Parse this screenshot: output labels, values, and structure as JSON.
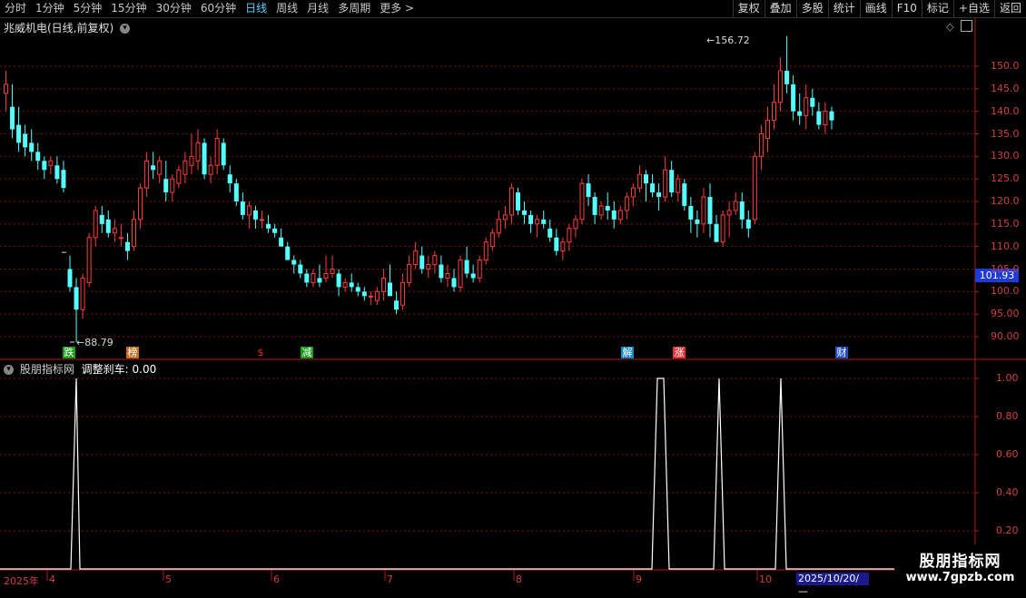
{
  "toolbar": {
    "periods": [
      "分时",
      "1分钟",
      "5分钟",
      "15分钟",
      "30分钟",
      "60分钟",
      "日线",
      "周线",
      "月线",
      "多周期",
      "更多 >"
    ],
    "active_period": "日线",
    "tools": [
      "复权",
      "叠加",
      "多股",
      "统计",
      "画线",
      "F10",
      "标记",
      "+自选",
      "返回"
    ]
  },
  "main_chart": {
    "title": "兆威机电(日线,前复权)",
    "high_label": "156.72",
    "low_label": "88.79",
    "current_price": "101.93",
    "y_ticks": [
      "150.0",
      "145.0",
      "140.0",
      "135.0",
      "130.0",
      "125.0",
      "120.0",
      "115.0",
      "110.0",
      "105.0",
      "100.0",
      "95.00",
      "90.00"
    ],
    "markers": [
      {
        "text": "跌",
        "color": "#1a9e1a"
      },
      {
        "text": "榜",
        "color": "#c07020"
      },
      {
        "text": "$",
        "color": "#e03030"
      },
      {
        "text": "减",
        "color": "#1a9e1a"
      },
      {
        "text": "解",
        "color": "#1a8ac0"
      },
      {
        "text": "涨",
        "color": "#e03030"
      },
      {
        "text": "财",
        "color": "#2050c0"
      }
    ]
  },
  "indicator": {
    "name": "股朋指标网",
    "line_label": "调整刹车: 0.00",
    "y_ticks": [
      "1.00",
      "0.80",
      "0.60",
      "0.40",
      "0.20"
    ]
  },
  "x_axis": {
    "year_label": "2025年",
    "months": [
      "4",
      "5",
      "6",
      "7",
      "8",
      "9",
      "10"
    ],
    "cursor_date": "2025/10/20/—"
  },
  "watermark": {
    "line1": "股朋指标网",
    "line2": "www.7gpzb.com"
  },
  "colors": {
    "up": "#ff3c3c",
    "down": "#54ffff",
    "grid": "#7a1010",
    "axis_text": "#d04040",
    "price_box": "#1e3ad8"
  },
  "chart_data": {
    "type": "candlestick",
    "ylim": [
      86,
      158
    ],
    "ohlc": [
      [
        144,
        149,
        140,
        146
      ],
      [
        141,
        146,
        134,
        136
      ],
      [
        137,
        141,
        131,
        133
      ],
      [
        135,
        137,
        130,
        132
      ],
      [
        133,
        136,
        129,
        131
      ],
      [
        131,
        133,
        127,
        129
      ],
      [
        129,
        130,
        125,
        127
      ],
      [
        128,
        130,
        126,
        129
      ],
      [
        128,
        130,
        124,
        125
      ],
      [
        127,
        129,
        122,
        123
      ],
      [
        105,
        108,
        100,
        101
      ],
      [
        101,
        103,
        88.79,
        96
      ],
      [
        96,
        104,
        94,
        103
      ],
      [
        102,
        113,
        101,
        112
      ],
      [
        112,
        119,
        110,
        118
      ],
      [
        117,
        119,
        113,
        115
      ],
      [
        116,
        118,
        112,
        113
      ],
      [
        113,
        116,
        111,
        114
      ],
      [
        112,
        115,
        110,
        112
      ],
      [
        111,
        113,
        107,
        109
      ],
      [
        110,
        118,
        109,
        116
      ],
      [
        116,
        124,
        114,
        123
      ],
      [
        123,
        131,
        121,
        129
      ],
      [
        128,
        131,
        125,
        127
      ],
      [
        126,
        130,
        124,
        129
      ],
      [
        125,
        129,
        120,
        122
      ],
      [
        122,
        126,
        120,
        125
      ],
      [
        124,
        128,
        123,
        127
      ],
      [
        126,
        131,
        124,
        129
      ],
      [
        128,
        135,
        126,
        130
      ],
      [
        129,
        136,
        127,
        133
      ],
      [
        133,
        134,
        125,
        126
      ],
      [
        126,
        130,
        124,
        128
      ],
      [
        128,
        136,
        126,
        134
      ],
      [
        133,
        134,
        127,
        128
      ],
      [
        126,
        128,
        122,
        124
      ],
      [
        124,
        125,
        119,
        120
      ],
      [
        120,
        122,
        116,
        117
      ],
      [
        117,
        120,
        114,
        119
      ],
      [
        118,
        119,
        114,
        116
      ],
      [
        116,
        118,
        114,
        116
      ],
      [
        115,
        117,
        113,
        114
      ],
      [
        114,
        115,
        112,
        113
      ],
      [
        112,
        114,
        110,
        110
      ],
      [
        110,
        111,
        107,
        107
      ],
      [
        107,
        108,
        104,
        106
      ],
      [
        106,
        107,
        103,
        104
      ],
      [
        104,
        105,
        101,
        102
      ],
      [
        102,
        105,
        101,
        104
      ],
      [
        103,
        106,
        101,
        102
      ],
      [
        103,
        108,
        102,
        104
      ],
      [
        104,
        108,
        103,
        105
      ],
      [
        104,
        105,
        99,
        101
      ],
      [
        101,
        103,
        100,
        102
      ],
      [
        102,
        104,
        100,
        101
      ],
      [
        101,
        102,
        99,
        100
      ],
      [
        100,
        101,
        98,
        99
      ],
      [
        99,
        100,
        97,
        99
      ],
      [
        98,
        101,
        97,
        100
      ],
      [
        100,
        105,
        98,
        103
      ],
      [
        102,
        106,
        99,
        99
      ],
      [
        98,
        100,
        95,
        96
      ],
      [
        97,
        104,
        96,
        102
      ],
      [
        102,
        108,
        101,
        106
      ],
      [
        106,
        111,
        105,
        109
      ],
      [
        108,
        110,
        104,
        105
      ],
      [
        105,
        108,
        103,
        106
      ],
      [
        106,
        109,
        104,
        108
      ],
      [
        106,
        108,
        102,
        103
      ],
      [
        103,
        106,
        101,
        104
      ],
      [
        103,
        105,
        100,
        101
      ],
      [
        101,
        108,
        100,
        107
      ],
      [
        107,
        110,
        103,
        104
      ],
      [
        104,
        106,
        102,
        103
      ],
      [
        103,
        108,
        102,
        107
      ],
      [
        107,
        112,
        106,
        111
      ],
      [
        110,
        114,
        109,
        113
      ],
      [
        113,
        118,
        112,
        116
      ],
      [
        116,
        119,
        114,
        117
      ],
      [
        117,
        124,
        115,
        123
      ],
      [
        122,
        123,
        117,
        118
      ],
      [
        118,
        120,
        115,
        117
      ],
      [
        117,
        118,
        113,
        115
      ],
      [
        115,
        117,
        112,
        116
      ],
      [
        116,
        118,
        114,
        115
      ],
      [
        114,
        116,
        111,
        112
      ],
      [
        112,
        114,
        108,
        109
      ],
      [
        109,
        112,
        107,
        111
      ],
      [
        111,
        115,
        109,
        114
      ],
      [
        114,
        117,
        112,
        116
      ],
      [
        116,
        125,
        115,
        124
      ],
      [
        124,
        126,
        119,
        121
      ],
      [
        121,
        122,
        115,
        117
      ],
      [
        117,
        120,
        116,
        119
      ],
      [
        119,
        122,
        116,
        118
      ],
      [
        118,
        120,
        114,
        116
      ],
      [
        116,
        119,
        115,
        118
      ],
      [
        118,
        122,
        116,
        121
      ],
      [
        121,
        124,
        119,
        123
      ],
      [
        123,
        128,
        122,
        126
      ],
      [
        126,
        127,
        120,
        124
      ],
      [
        124,
        126,
        121,
        122
      ],
      [
        122,
        124,
        118,
        121
      ],
      [
        121,
        130,
        120,
        127
      ],
      [
        127,
        129,
        121,
        122
      ],
      [
        122,
        126,
        120,
        125
      ],
      [
        124,
        125,
        118,
        119
      ],
      [
        119,
        121,
        113,
        116
      ],
      [
        116,
        118,
        112,
        115
      ],
      [
        115,
        123,
        113,
        121
      ],
      [
        121,
        124,
        112,
        115
      ],
      [
        115,
        117,
        111,
        111
      ],
      [
        111,
        118,
        110,
        117
      ],
      [
        117,
        120,
        112,
        118
      ],
      [
        118,
        122,
        117,
        120
      ],
      [
        120,
        122,
        114,
        116
      ],
      [
        116,
        118,
        112,
        114
      ],
      [
        116,
        131,
        115,
        130
      ],
      [
        130,
        137,
        127,
        135
      ],
      [
        134,
        141,
        131,
        138
      ],
      [
        138,
        146,
        136,
        142
      ],
      [
        142,
        152,
        140,
        149
      ],
      [
        149,
        156.72,
        144,
        146
      ],
      [
        146,
        148,
        138,
        140
      ],
      [
        140,
        144,
        137,
        139
      ],
      [
        139,
        146,
        136,
        143
      ],
      [
        143,
        145,
        139,
        141
      ],
      [
        140,
        142,
        136,
        137
      ],
      [
        137,
        142,
        135,
        140
      ],
      [
        140,
        141,
        136,
        138
      ]
    ],
    "indicator_series_note": "binary signal (0 or 1)"
  }
}
